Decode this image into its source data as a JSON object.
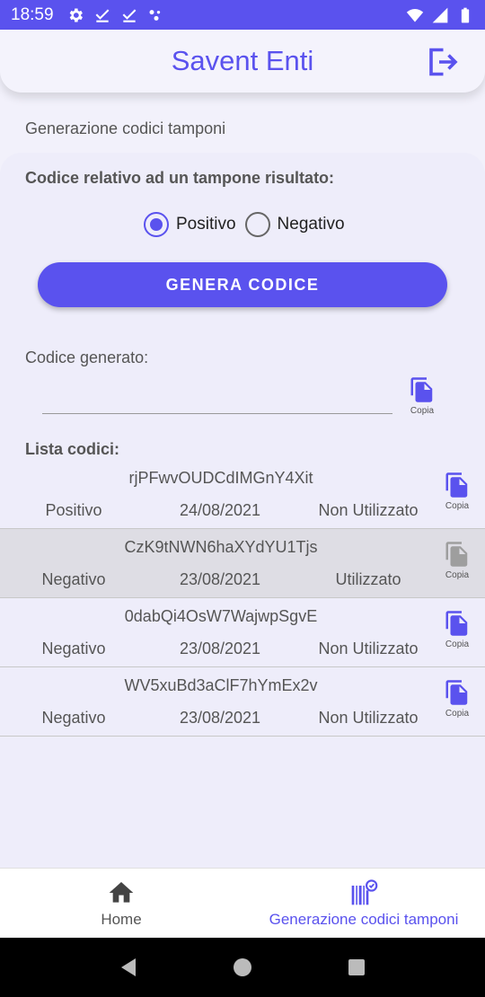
{
  "status_bar": {
    "time": "18:59"
  },
  "app_bar": {
    "title": "Savent Enti"
  },
  "section_title": "Generazione codici tamponi",
  "form": {
    "prompt": "Codice relativo ad un tampone risultato:",
    "options": [
      "Positivo",
      "Negativo"
    ],
    "selected": "Positivo",
    "generate_label": "GENERA CODICE",
    "generated_label": "Codice generato:",
    "generated_value": "",
    "copy_label": "Copia"
  },
  "list": {
    "title": "Lista codici:",
    "items": [
      {
        "code": "rjPFwvOUDCdIMGnY4Xit",
        "type": "Positivo",
        "date": "24/08/2021",
        "status": "Non Utilizzato",
        "copy": "Copia"
      },
      {
        "code": "CzK9tNWN6haXYdYU1Tjs",
        "type": "Negativo",
        "date": "23/08/2021",
        "status": "Utilizzato",
        "copy": "Copia"
      },
      {
        "code": "0dabQi4OsW7WajwpSgvE",
        "type": "Negativo",
        "date": "23/08/2021",
        "status": "Non Utilizzato",
        "copy": "Copia"
      },
      {
        "code": "WV5xuBd3aClF7hYmEx2v",
        "type": "Negativo",
        "date": "23/08/2021",
        "status": "Non Utilizzato",
        "copy": "Copia"
      }
    ]
  },
  "bottom_nav": {
    "home": "Home",
    "generation": "Generazione codici tamponi"
  },
  "colors": {
    "accent": "#5a52ee",
    "used_row": "#dedde4",
    "disabled_icon": "#9e9e9e"
  },
  "icons": {
    "logout": "logout-icon",
    "copy": "copy-icon",
    "home": "home-icon",
    "barcode": "barcode-icon"
  }
}
